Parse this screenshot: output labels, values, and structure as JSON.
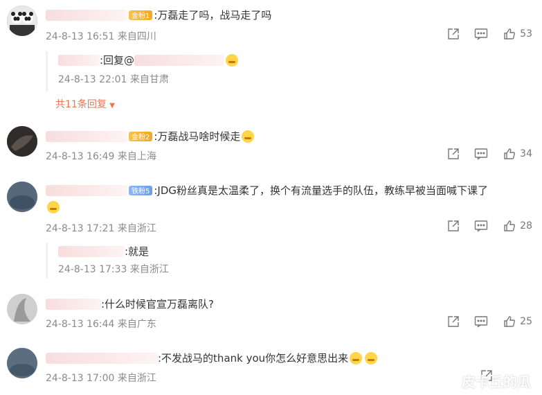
{
  "comments": [
    {
      "text": ":万磊走了吗，战马走了吗",
      "badge": "金粉1",
      "time": "24-8-13 16:51 来自四川",
      "likes": "53",
      "reply": {
        "text_prefix": ":回复@",
        "time": "24-8-13 22:01 来自甘肃"
      },
      "more": "共11条回复"
    },
    {
      "text": ":万磊战马啥时候走",
      "badge": "金粉2",
      "time": "24-8-13 16:49 来自上海",
      "likes": "34"
    },
    {
      "text_line1": ":JDG粉丝真是太温柔了，换个有流量选手的队伍，教练早被当面喊下课了",
      "badge": "铁粉5",
      "time": "24-8-13 17:21 来自浙江",
      "likes": "28",
      "reply": {
        "text": ":就是",
        "time": "24-8-13 17:33 来自浙江"
      }
    },
    {
      "text": ":什么时候官宣万磊离队?",
      "time": "24-8-13 16:44 来自广东",
      "likes": "25"
    },
    {
      "text": ":不发战马的thank you你怎么好意思出来",
      "time": "24-8-13 17:00 来自浙江"
    }
  ],
  "watermark": "皮卡丘的瓜",
  "colors": {
    "link": "#eb7350",
    "meta": "#8a8a8a",
    "text": "#333333",
    "icon": "#777777"
  },
  "icons": [
    "share-icon",
    "comment-icon",
    "like-icon",
    "chevron-down-icon"
  ]
}
